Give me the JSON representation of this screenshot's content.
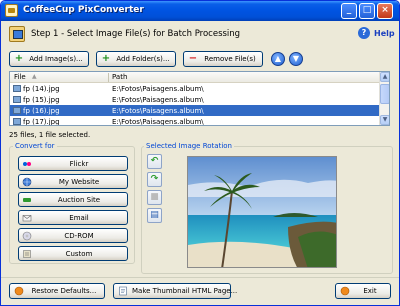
{
  "window": {
    "title": "CoffeeCup PixConverter"
  },
  "header": {
    "step_title": "Step 1 - Select Image File(s) for Batch Processing",
    "help_label": "Help"
  },
  "toolbar": {
    "add_images": "Add Image(s)...",
    "add_folders": "Add Folder(s)...",
    "remove_files": "Remove File(s)"
  },
  "filelist": {
    "columns": [
      "File",
      "Path"
    ],
    "rows": [
      {
        "file": "fp (14).jpg",
        "path": "E:\\Fotos\\Paisagens.album\\"
      },
      {
        "file": "fp (15).jpg",
        "path": "E:\\Fotos\\Paisagens.album\\"
      },
      {
        "file": "fp (16).jpg",
        "path": "E:\\Fotos\\Paisagens.album\\",
        "selected": true
      },
      {
        "file": "fp (17).jpg",
        "path": "E:\\Fotos\\Paisagens.album\\"
      }
    ]
  },
  "status": "25 files, 1 file selected.",
  "convert_for": {
    "title": "Convert for",
    "buttons": [
      "Flickr",
      "My Website",
      "Auction Site",
      "Email",
      "CD-ROM",
      "Custom"
    ]
  },
  "rotation": {
    "title": "Selected Image Rotation"
  },
  "footer": {
    "restore_defaults": "Restore Defaults...",
    "make_thumbnail": "Make Thumbnail HTML Page...",
    "exit": "Exit"
  },
  "colors": {
    "title_bar": "#0054e3",
    "selection": "#316ac5",
    "group_label": "#0046d5"
  }
}
